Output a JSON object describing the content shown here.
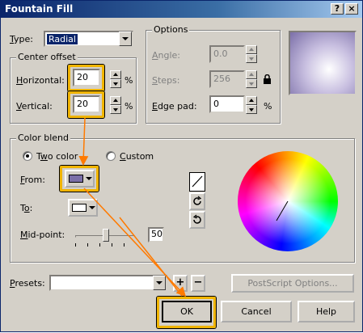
{
  "window": {
    "title": "Fountain Fill",
    "help_btn": "?",
    "close_btn": "×"
  },
  "type": {
    "label": "Type:",
    "value": "Radial"
  },
  "center_offset": {
    "title": "Center offset",
    "horizontal_label": "Horizontal:",
    "horizontal_value": "20",
    "vertical_label": "Vertical:",
    "vertical_value": "20",
    "unit": "%"
  },
  "options": {
    "title": "Options",
    "angle_label": "Angle:",
    "angle_value": "0.0",
    "steps_label": "Steps:",
    "steps_value": "256",
    "edge_label": "Edge pad:",
    "edge_value": "0",
    "unit": "%"
  },
  "color_blend": {
    "title": "Color blend",
    "two_color_label": "Two color",
    "custom_label": "Custom",
    "from_label": "From:",
    "to_label": "To:",
    "midpoint_label": "Mid-point:",
    "midpoint_value": "50",
    "from_color": "#7b6fa8",
    "to_color": "#ffffff"
  },
  "presets": {
    "label": "Presets:",
    "value": "",
    "postscript_label": "PostScript Options..."
  },
  "buttons": {
    "ok": "OK",
    "cancel": "Cancel",
    "help": "Help",
    "add": "+",
    "remove": "−"
  }
}
